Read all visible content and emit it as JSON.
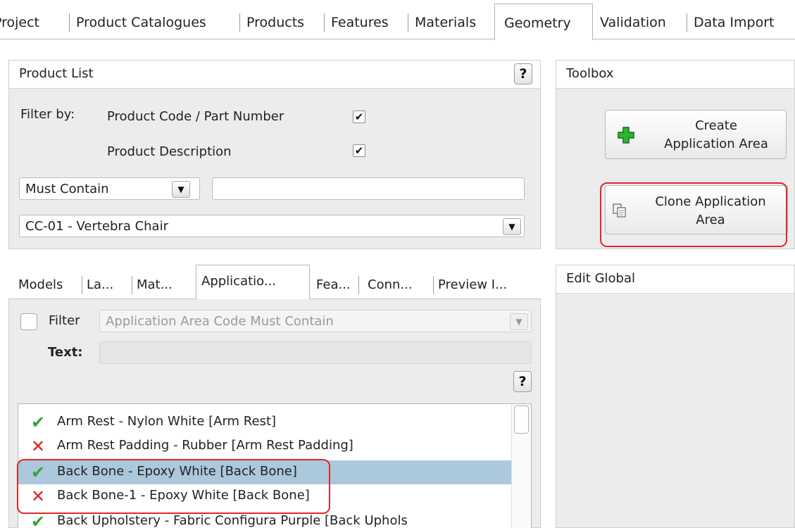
{
  "top_tabs": {
    "project": "Project",
    "product_catalogues": "Product Catalogues",
    "products": "Products",
    "features": "Features",
    "materials": "Materials",
    "geometry": "Geometry",
    "validation": "Validation",
    "data_import": "Data Import"
  },
  "product_list": {
    "title": "Product List",
    "help": "?",
    "filter_by_label": "Filter by:",
    "filter_code_label": "Product Code / Part Number",
    "filter_code_checked": "✔",
    "filter_desc_label": "Product Description",
    "filter_desc_checked": "✔",
    "match_mode": "Must Contain",
    "search_text": "",
    "selected_product": "CC-01 - Vertebra Chair"
  },
  "toolbox": {
    "title": "Toolbox",
    "create_line1": "Create",
    "create_line2": "Application Area",
    "clone_line1": "Clone Application",
    "clone_line2": "Area"
  },
  "edit_global": {
    "title": "Edit Global"
  },
  "sub_tabs": {
    "models": "Models",
    "layers": "La...",
    "materials": "Mat...",
    "application": "Applicatio...",
    "features": "Fea...",
    "connections": "Conn...",
    "preview": "Preview I..."
  },
  "app_area": {
    "filter_label": "Filter",
    "filter_placeholder": "Application Area Code Must Contain",
    "text_label": "Text:",
    "text_value": "",
    "help": "?",
    "items": [
      {
        "status": "valid",
        "label": "Arm Rest - Nylon White [Arm Rest]"
      },
      {
        "status": "invalid",
        "label": "Arm Rest Padding - Rubber [Arm Rest Padding]"
      },
      {
        "status": "valid",
        "label": "Back Bone - Epoxy White [Back Bone]",
        "selected": true
      },
      {
        "status": "invalid",
        "label": "Back Bone-1 - Epoxy White [Back Bone]"
      },
      {
        "status": "valid",
        "label": "Back Upholstery - Fabric Configura Purple [Back Uphols"
      }
    ]
  },
  "icons": {
    "valid": "check-icon",
    "invalid": "cross-icon",
    "create": "plus-icon",
    "clone": "copy-icon"
  },
  "colors": {
    "selection": "#abc8dd",
    "highlight": "#e1282a",
    "valid": "#35a535",
    "invalid": "#e02020"
  }
}
